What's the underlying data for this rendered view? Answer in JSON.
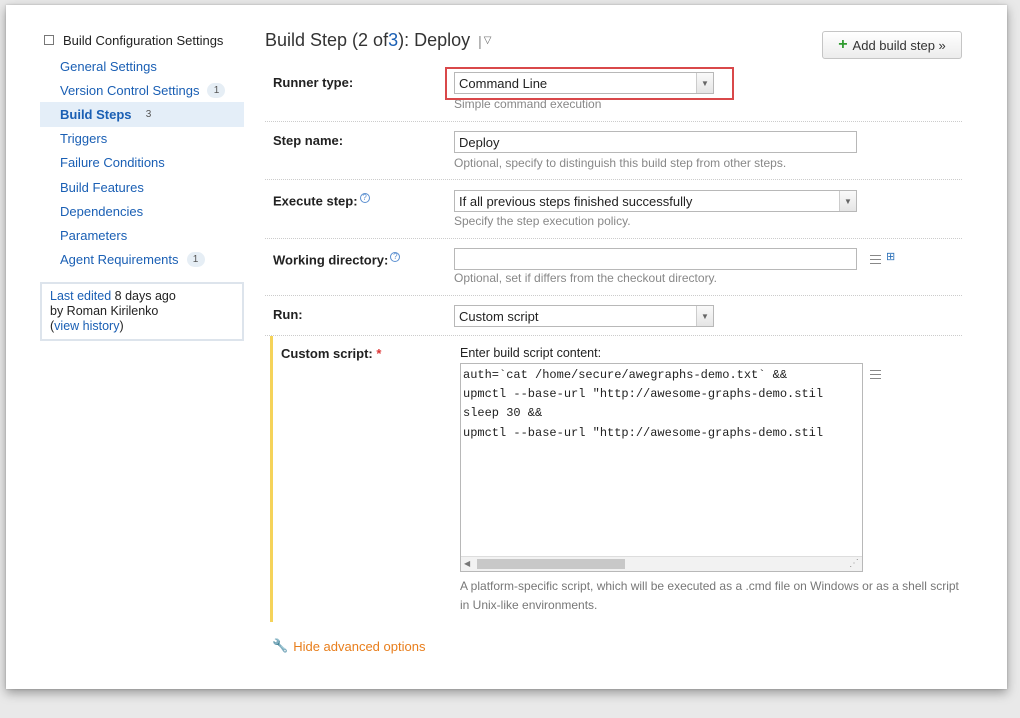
{
  "sidebar": {
    "header": "Build Configuration Settings",
    "items": [
      {
        "label": "General Settings",
        "badge": ""
      },
      {
        "label": "Version Control Settings",
        "badge": "1"
      },
      {
        "label": "Build Steps",
        "badge": "3"
      },
      {
        "label": "Triggers",
        "badge": ""
      },
      {
        "label": "Failure Conditions",
        "badge": ""
      },
      {
        "label": "Build Features",
        "badge": ""
      },
      {
        "label": "Dependencies",
        "badge": ""
      },
      {
        "label": "Parameters",
        "badge": ""
      },
      {
        "label": "Agent Requirements",
        "badge": "1"
      }
    ],
    "history": {
      "last_edited_link": "Last edited",
      "ago": " 8 days ago",
      "by": "by Roman Kirilenko",
      "open_paren": "(",
      "view_history": "view history",
      "close_paren": ")"
    }
  },
  "header": {
    "title_prefix": "Build Step (2 of ",
    "title_link": "3",
    "title_suffix": "): Deploy",
    "sep": "|",
    "caret": "▽",
    "add_button": "Add build step »",
    "add_icon": "+"
  },
  "form": {
    "runner": {
      "label": "Runner type:",
      "value": "Command Line",
      "hint": "Simple command execution"
    },
    "step_name": {
      "label": "Step name:",
      "value": "Deploy",
      "hint": "Optional, specify to distinguish this build step from other steps."
    },
    "execute": {
      "label": "Execute step:",
      "value": "If all previous steps finished successfully",
      "hint": "Specify the step execution policy."
    },
    "working_dir": {
      "label": "Working directory:",
      "value": "",
      "hint": "Optional, set if differs from the checkout directory."
    },
    "run": {
      "label": "Run:",
      "value": "Custom script"
    },
    "custom_script": {
      "label": "Custom script:",
      "required": "*",
      "caption": "Enter build script content:",
      "content": "auth=`cat /home/secure/awegraphs-demo.txt` &&\nupmctl --base-url \"http://awesome-graphs-demo.stil\nsleep 30 &&\nupmctl --base-url \"http://awesome-graphs-demo.stil",
      "description": "A platform-specific script, which will be executed as a .cmd file on Windows or as a shell script in Unix-like environments."
    }
  },
  "advanced": {
    "label": "Hide advanced options"
  },
  "icons": {
    "help": "?",
    "dropdown": "▼",
    "resize": "⋰",
    "scroll_left": "◀"
  }
}
